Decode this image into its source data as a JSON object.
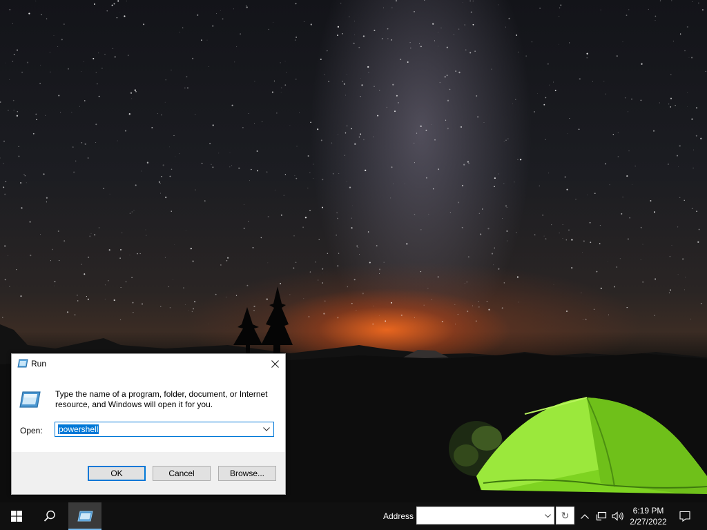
{
  "run_dialog": {
    "title": "Run",
    "description": "Type the name of a program, folder, document, or Internet resource, and Windows will open it for you.",
    "open_label": "Open:",
    "open_value": "powershell",
    "ok_label": "OK",
    "cancel_label": "Cancel",
    "browse_label": "Browse..."
  },
  "taskbar": {
    "address_label": "Address",
    "address_value": "",
    "time": "6:19 PM",
    "date": "2/27/2022",
    "icons": [
      "windows-start-icon",
      "search-icon",
      "run-app-icon",
      "chevron-up-icon",
      "network-icon",
      "volume-icon",
      "notification-icon"
    ]
  },
  "colors": {
    "accent": "#0078d7",
    "taskbar_bg": "#101010",
    "tent_green": "#8fe22c"
  }
}
